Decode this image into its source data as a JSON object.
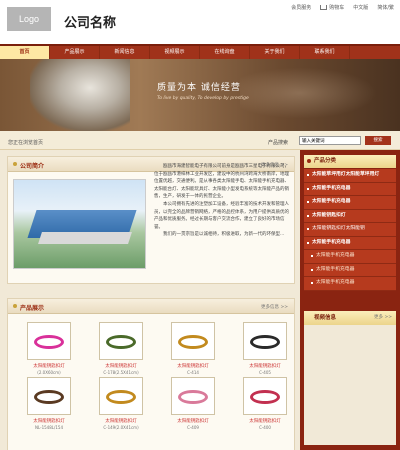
{
  "header": {
    "logo": "Logo",
    "company_name": "公司名称",
    "links": {
      "home": "会员服务",
      "cart": "购物车",
      "lang_cn": "中文版",
      "lang_en": "简体/繁"
    }
  },
  "nav": {
    "items": [
      "首页",
      "产品展示",
      "新闻信息",
      "视频展示",
      "在线询盘",
      "关于我们",
      "联系我们"
    ]
  },
  "banner": {
    "slogan": "质量为本  诚信经营",
    "slogan_en": "To live by quality, To develop by prestige"
  },
  "crumb": {
    "text": "您正在浏览首页",
    "search_label": "产品搜索",
    "search_value": "输入关键词",
    "search_button": "搜索"
  },
  "intro": {
    "title": "公司简介",
    "more": "更多信息 >>",
    "paragraphs": [
      "瓯瓯市海建智能电子有限公司前身是瓯瓯市三星电子有限公司，位于瓯瓯市港梓林工业开发区，建设中的杭州湾跨海大桥南岸，地理位置优越，交通便利。是从事各类太阳能手电、太阳能手机充电器、太阳能台灯、太阳能玩具灯、太阳能小型发电系统等太阳能产品的销售，生产，研发于一体的民营企业。",
      "本公司拥有先进的注塑加工设备，经验丰富的技术开发和管理人员，以完全的品牌营销网络，严格的品控体系，为用户提供高质优的产品和优质服务。经过长期与客户交流合作，建立了良好的市场信誉。",
      "我们的一贯宗旨是以诚相待，积极进取，为新一代的环保型..."
    ]
  },
  "products": {
    "title": "产品展示",
    "more": "更多信息 >>",
    "items": [
      {
        "name": "太阳能钥匙扣灯",
        "code": "(2.0X60cm)"
      },
      {
        "name": "太阳能钥匙扣灯",
        "code": "C-178(2.5X41cm)"
      },
      {
        "name": "太阳能钥匙扣灯",
        "code": "C-414"
      },
      {
        "name": "太阳能钥匙扣灯",
        "code": "C-405"
      },
      {
        "name": "太阳能钥匙扣灯",
        "code": "NL-1548L/154"
      },
      {
        "name": "太阳能钥匙扣灯",
        "code": "C-149(2.0X41cm)"
      },
      {
        "name": "太阳能钥匙扣灯",
        "code": "C-409"
      },
      {
        "name": "太阳能钥匙扣灯",
        "code": "C-400"
      }
    ]
  },
  "sidebar": {
    "category_title": "产品分类",
    "categories": [
      {
        "label": "太阳能草坪用灯太阳能草坪用灯",
        "type": "bold"
      },
      {
        "label": "太阳能手机充电器",
        "type": "bold"
      },
      {
        "label": "太阳能手机充电器",
        "type": "bold"
      },
      {
        "label": "太阳能钥匙扣灯",
        "type": "bold"
      },
      {
        "label": "太阳能钥匙扣灯太阳能钥",
        "type": "normal"
      },
      {
        "label": "太阳能手机充电器",
        "type": "bold"
      },
      {
        "label": "太阳能手机充电器",
        "type": "sub"
      },
      {
        "label": "太阳能手机充电器",
        "type": "sub"
      },
      {
        "label": "太阳能手机充电器",
        "type": "sub"
      }
    ],
    "video_title": "视频信息",
    "video_more": "更多 >>"
  },
  "colors": {
    "nav_bg": "#a0321a",
    "sidebar_bg": "#8a2411",
    "accent": "#9a2a10"
  }
}
